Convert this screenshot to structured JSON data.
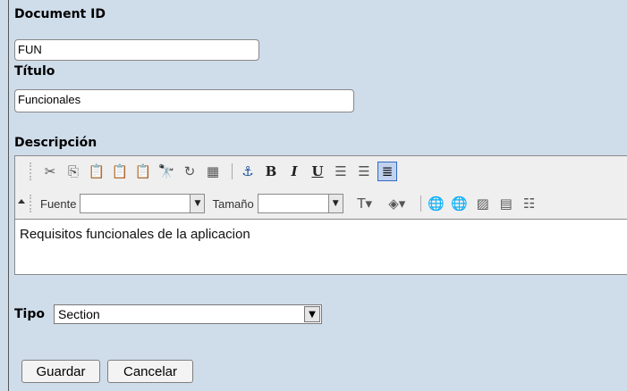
{
  "form": {
    "doc_id_label": "Document ID",
    "doc_id_value": "FUN",
    "title_label": "Título",
    "title_value": "Funcionales",
    "description_label": "Descripción",
    "description_text": "Requisitos funcionales de la aplicacion",
    "type_label": "Tipo",
    "type_value": "Section",
    "save_label": "Guardar",
    "cancel_label": "Cancelar"
  },
  "editor_toolbar": {
    "font_label": "Fuente",
    "size_label": "Tamaño",
    "bold": "B",
    "italic": "I",
    "underline": "U",
    "anchor": "⚓",
    "row1_icons": [
      "cut-icon",
      "copy-icon",
      "paste-icon",
      "paste-text-icon",
      "paste-word-icon",
      "find-icon",
      "replace-icon",
      "select-all-icon",
      "anchor-icon",
      "bold-icon",
      "italic-icon",
      "underline-icon",
      "ordered-list-icon",
      "unordered-list-icon",
      "justify-icon"
    ],
    "row2_icons": [
      "text-color-icon",
      "bg-color-icon",
      "link-icon",
      "unlink-icon",
      "image-icon",
      "table-icon",
      "horizontal-rule-icon"
    ]
  }
}
